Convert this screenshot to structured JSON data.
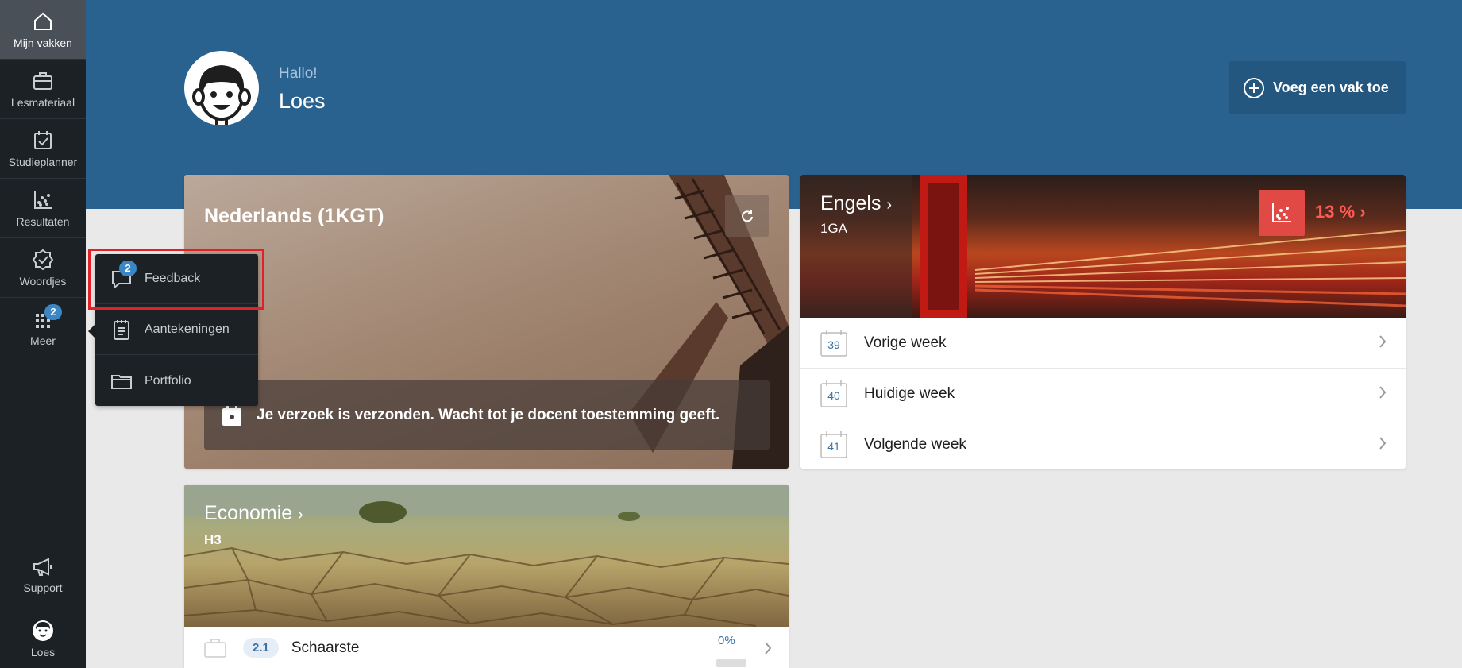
{
  "sidebar": {
    "items": [
      {
        "label": "Mijn vakken",
        "icon": "home-icon"
      },
      {
        "label": "Lesmateriaal",
        "icon": "briefcase-icon"
      },
      {
        "label": "Studieplanner",
        "icon": "calendar-check-icon"
      },
      {
        "label": "Resultaten",
        "icon": "chart-icon"
      },
      {
        "label": "Woordjes",
        "icon": "badge-check-icon"
      },
      {
        "label": "Meer",
        "icon": "grid-icon",
        "badge": "2"
      }
    ],
    "support": {
      "label": "Support",
      "icon": "megaphone-icon"
    },
    "user": {
      "label": "Loes",
      "icon": "avatar-icon"
    }
  },
  "header": {
    "greeting": "Hallo!",
    "name": "Loes",
    "add_button": "Voeg een vak toe"
  },
  "popup": {
    "items": [
      {
        "label": "Feedback",
        "icon": "chat-icon",
        "badge": "2"
      },
      {
        "label": "Aantekeningen",
        "icon": "notes-icon"
      },
      {
        "label": "Portfolio",
        "icon": "folder-icon"
      }
    ]
  },
  "cards": {
    "nederlands": {
      "title": "Nederlands (1KGT)",
      "message": "Je verzoek is verzonden. Wacht tot je docent toestemming geeft."
    },
    "engels": {
      "title": "Engels",
      "subtitle": "1GA",
      "score": "13 %",
      "weeks": [
        {
          "num": "39",
          "label": "Vorige week"
        },
        {
          "num": "40",
          "label": "Huidige week"
        },
        {
          "num": "41",
          "label": "Volgende week"
        }
      ]
    },
    "economie": {
      "title": "Economie",
      "subtitle": "H3",
      "chapter_num": "2.1",
      "chapter_title": "Schaarste",
      "progress": "0%"
    }
  },
  "colors": {
    "header_bg": "#2a628f",
    "sidebar_bg": "#1c2126",
    "accent": "#3b86c6",
    "score_red": "#e14a44",
    "highlight": "#e3202a"
  }
}
